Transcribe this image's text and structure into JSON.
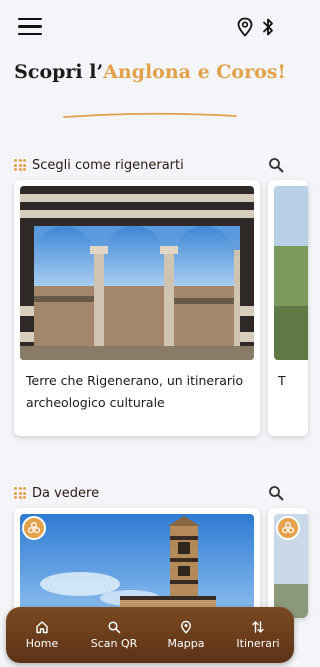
{
  "header": {
    "menu_icon": "hamburger-menu-icon",
    "location_icon": "map-pin-icon",
    "bluetooth_icon": "bluetooth-icon",
    "title_prefix": "Scopri l’",
    "title_highlight": "Anglona e Coros!"
  },
  "sections": [
    {
      "title": "Scegli come rigenerarti",
      "search_icon": "search-icon",
      "cards": [
        {
          "text": "Terre che Rigenerano, un itinerario archeologico culturale"
        },
        {
          "text": "T"
        }
      ]
    },
    {
      "title": "Da vedere",
      "search_icon": "search-icon",
      "cards": [
        {
          "badge_icon": "triskelion-icon"
        },
        {
          "badge_icon": "triskelion-icon"
        }
      ]
    }
  ],
  "navbar": {
    "items": [
      {
        "label": "Home",
        "icon": "home-icon"
      },
      {
        "label": "Scan QR",
        "icon": "search-icon"
      },
      {
        "label": "Mappa",
        "icon": "map-pin-icon"
      },
      {
        "label": "Itinerari",
        "icon": "swap-arrows-icon"
      }
    ]
  },
  "colors": {
    "accent": "#e3a14b",
    "navbar": "#6b3d1c",
    "background": "#f3f5f9"
  }
}
